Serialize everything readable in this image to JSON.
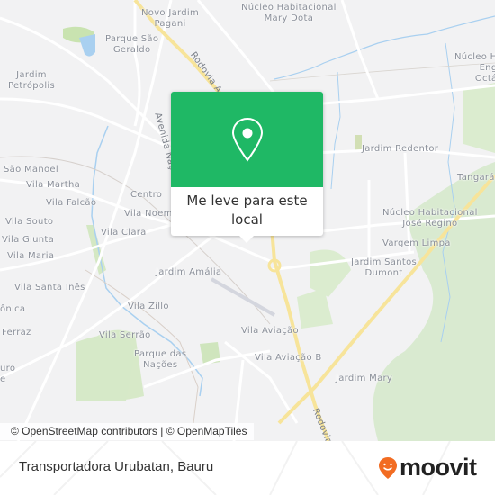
{
  "map": {
    "colors": {
      "background": "#f2f2f3",
      "road": "#ffffff",
      "highway": "#f7e49a",
      "park": "#d5e8c4",
      "water": "#a9d0f0",
      "label": "#8a8f99"
    },
    "labels": [
      {
        "id": "novo-jardim-pagani",
        "text": "Novo Jardim\nPagani"
      },
      {
        "id": "nucleo-mary-dota",
        "text": "Núcleo Habitacional\nMary Dota"
      },
      {
        "id": "parque-sao-geraldo",
        "text": "Parque São\nGeraldo"
      },
      {
        "id": "jardim-petropolis",
        "text": "Jardim\nPetrópolis"
      },
      {
        "id": "nucleo-eng-octavio",
        "text": "Núcleo H\nEng\nOctá"
      },
      {
        "id": "jardim-redentor",
        "text": "Jardim Redentor"
      },
      {
        "id": "tangara",
        "text": "Tangará"
      },
      {
        "id": "sao-manoel",
        "text": "São Manoel"
      },
      {
        "id": "vila-martha",
        "text": "Vila Martha"
      },
      {
        "id": "vila-falcao",
        "text": "Vila Falcão"
      },
      {
        "id": "centro",
        "text": "Centro"
      },
      {
        "id": "vila-noemia",
        "text": "Vila Noem"
      },
      {
        "id": "vila-souto",
        "text": "Vila Souto"
      },
      {
        "id": "vila-clara",
        "text": "Vila Clara"
      },
      {
        "id": "vila-giunta",
        "text": "Vila Giunta"
      },
      {
        "id": "vila-maria",
        "text": "Vila Maria"
      },
      {
        "id": "nucleo-jose-regino",
        "text": "Núcleo Habitacional\nJosé Regino"
      },
      {
        "id": "vargem-limpa",
        "text": "Vargem Limpa"
      },
      {
        "id": "jardim-santos-dumont",
        "text": "Jardim Santos\nDumont"
      },
      {
        "id": "jardim-amalia",
        "text": "Jardim Amália"
      },
      {
        "id": "vila-santa-ines",
        "text": "Vila Santa Inês"
      },
      {
        "id": "veronica",
        "text": "ônica"
      },
      {
        "id": "vila-zillo",
        "text": "Vila Zillo"
      },
      {
        "id": "ferraz",
        "text": "Ferraz"
      },
      {
        "id": "vila-serrao",
        "text": "Vila Serrão"
      },
      {
        "id": "vila-aviacao",
        "text": "Vila Aviação"
      },
      {
        "id": "parque-das-nacoes",
        "text": "Parque das\nNações"
      },
      {
        "id": "ouro",
        "text": "uro\ne"
      },
      {
        "id": "vila-aviacao-b",
        "text": "Vila Aviação B"
      },
      {
        "id": "jardim-mary",
        "text": "Jardim Mary"
      }
    ],
    "roads": [
      {
        "id": "rodovia-north",
        "text": "Rodovia A"
      },
      {
        "id": "avenida-nacoes",
        "text": "Avenida Naç"
      },
      {
        "id": "rodovia-south",
        "text": "Rodovia"
      }
    ]
  },
  "popup": {
    "icon": "map-pin-icon",
    "label": "Me leve para este local",
    "color": "#1fb865"
  },
  "attribution": "© OpenStreetMap contributors | © OpenMapTiles",
  "footer": {
    "place_title": "Transportadora Urubatan, Bauru",
    "brand": "moovit",
    "brand_color": "#f26c22"
  }
}
